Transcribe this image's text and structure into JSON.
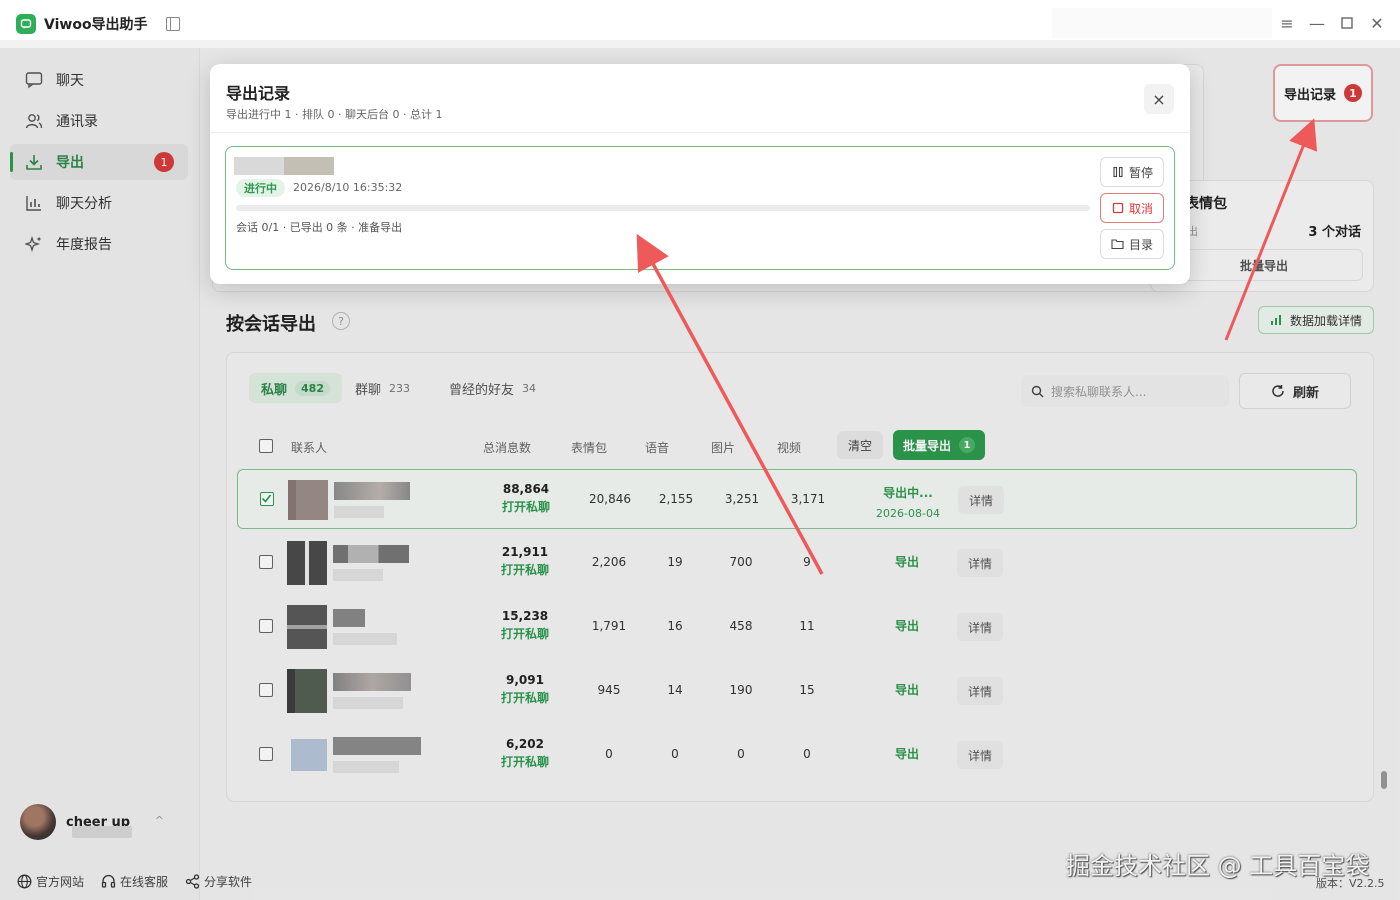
{
  "app": {
    "title": "Viwoo导出助手"
  },
  "sidebar": {
    "items": [
      {
        "label": "聊天",
        "icon": "chat-icon"
      },
      {
        "label": "通讯录",
        "icon": "contacts-icon"
      },
      {
        "label": "导出",
        "icon": "download-icon",
        "badge": "1",
        "active": true
      },
      {
        "label": "聊天分析",
        "icon": "bar-chart-icon"
      },
      {
        "label": "年度报告",
        "icon": "sparkle-icon"
      }
    ],
    "user": {
      "name": "cheer up"
    }
  },
  "footer": {
    "links": [
      {
        "label": "官方网站",
        "icon": "globe-icon"
      },
      {
        "label": "在线客服",
        "icon": "headset-icon"
      },
      {
        "label": "分享软件",
        "icon": "share-icon"
      }
    ],
    "version": "版本：V2.2.5",
    "watermark": "掘金技术社区 @ 工具百宝袋"
  },
  "header": {
    "export_records_label": "导出记录",
    "export_records_badge": "1"
  },
  "bg_card": {
    "title_fragment": "表情包",
    "count": "3 个对话",
    "batch_label": "批量导出",
    "side_char": "出"
  },
  "section": {
    "title": "按会话导出",
    "help": "?",
    "data_detail_label": "数据加载详情"
  },
  "tabs": [
    {
      "label": "私聊",
      "count": "482",
      "active": true
    },
    {
      "label": "群聊",
      "count": "233"
    },
    {
      "label": "曾经的好友",
      "count": "34"
    }
  ],
  "search": {
    "placeholder": "搜索私聊联系人..."
  },
  "refresh_label": "刷新",
  "table": {
    "headers": {
      "contact": "联系人",
      "total": "总消息数",
      "emoji": "表情包",
      "voice": "语音",
      "image": "图片",
      "video": "视频"
    },
    "clear_label": "清空",
    "batch_label": "批量导出",
    "batch_count": "1",
    "open_label": "打开私聊",
    "detail_label": "详情",
    "rows": [
      {
        "total": "88,864",
        "emoji": "20,846",
        "voice": "2,155",
        "image": "3,251",
        "video": "3,171",
        "action": "导出中...",
        "date": "2026-08-04",
        "selected": true
      },
      {
        "total": "21,911",
        "emoji": "2,206",
        "voice": "19",
        "image": "700",
        "video": "9",
        "action": "导出",
        "selected": false
      },
      {
        "total": "15,238",
        "emoji": "1,791",
        "voice": "16",
        "image": "458",
        "video": "11",
        "action": "导出",
        "selected": false
      },
      {
        "total": "9,091",
        "emoji": "945",
        "voice": "14",
        "image": "190",
        "video": "15",
        "action": "导出",
        "selected": false
      },
      {
        "total": "6,202",
        "emoji": "0",
        "voice": "0",
        "image": "0",
        "video": "0",
        "action": "导出",
        "selected": false
      }
    ]
  },
  "modal": {
    "title": "导出记录",
    "subtitle": "导出进行中 1 · 排队 0 · 聊天后台 0 · 总计 1",
    "close": "×",
    "task": {
      "status": "进行中",
      "time": "2026/8/10 16:35:32",
      "progress": 0,
      "info": "会话 0/1 · 已导出 0 条 · 准备导出",
      "pause_label": "暂停",
      "cancel_label": "取消",
      "folder_label": "目录"
    }
  },
  "colors": {
    "accent": "#2e9a4f",
    "badge": "#d83b3b",
    "arrow": "#ee5a5a"
  }
}
